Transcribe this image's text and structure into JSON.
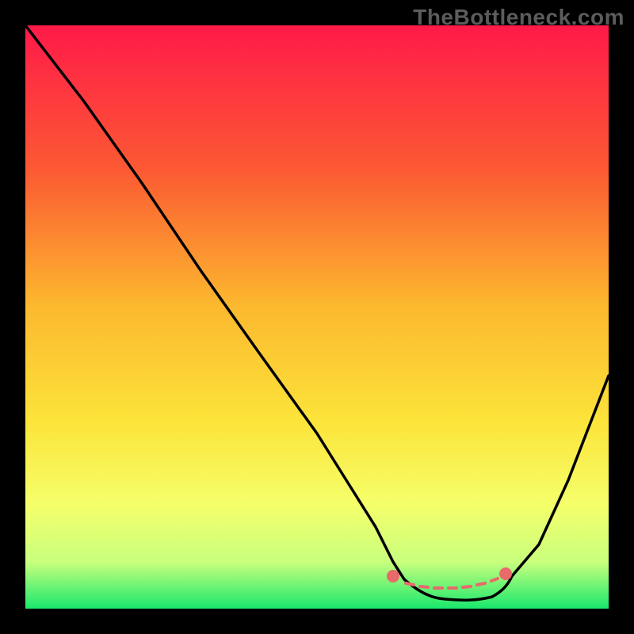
{
  "watermark": "TheBottleneck.com",
  "chart_data": {
    "type": "line",
    "title": "",
    "xlabel": "",
    "ylabel": "",
    "xlim": [
      0,
      100
    ],
    "ylim": [
      0,
      100
    ],
    "grid": false,
    "legend": false,
    "series": [
      {
        "name": "curve",
        "x": [
          0,
          10,
          20,
          30,
          40,
          50,
          55,
          60,
          63,
          65,
          70,
          75,
          80,
          83,
          88,
          93,
          100
        ],
        "y": [
          100,
          87,
          73,
          58,
          44,
          30,
          22,
          14,
          8,
          5,
          2,
          1.5,
          2,
          3,
          11,
          22,
          40
        ]
      },
      {
        "name": "optimal-band",
        "x_range": [
          60,
          80
        ],
        "y_level_approx": 4
      }
    ],
    "background_gradient": {
      "top": "#ff1a49",
      "mid1": "#fc7a2e",
      "mid2": "#fce43a",
      "mid3": "#f7ff79",
      "bottom": "#19e86d"
    },
    "markers": {
      "dot_color": "#e86a6a",
      "dot_count_approx": 12
    }
  }
}
